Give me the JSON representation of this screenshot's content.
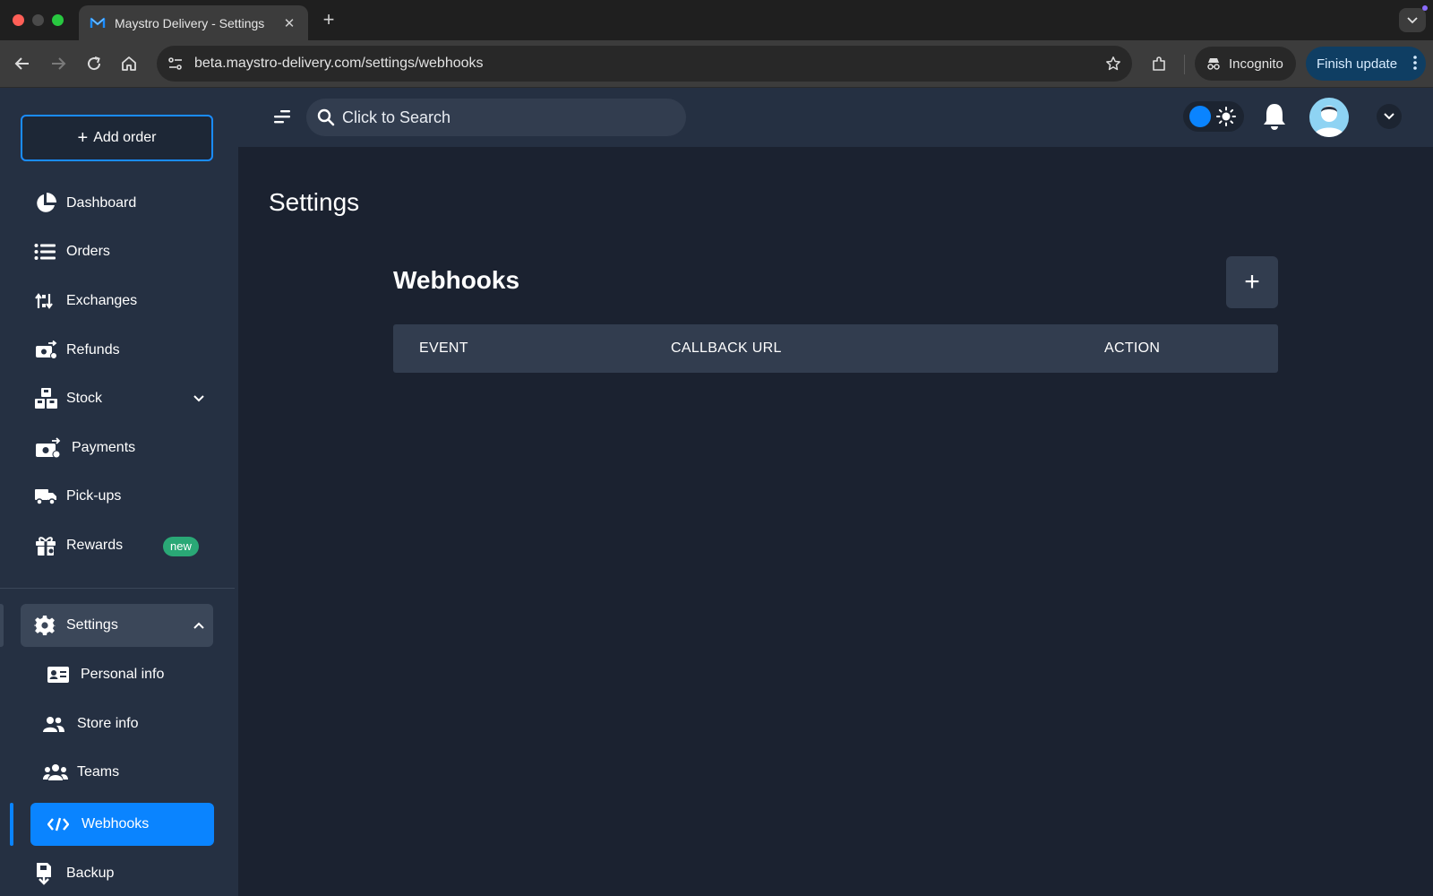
{
  "browser": {
    "tab_title": "Maystro Delivery - Settings",
    "url": "beta.maystro-delivery.com/settings/webhooks",
    "incognito_label": "Incognito",
    "finish_update_label": "Finish update"
  },
  "sidebar": {
    "add_order_label": "Add order",
    "items": [
      {
        "label": "Dashboard"
      },
      {
        "label": "Orders"
      },
      {
        "label": "Exchanges"
      },
      {
        "label": "Refunds"
      },
      {
        "label": "Stock"
      },
      {
        "label": "Payments"
      },
      {
        "label": "Pick-ups"
      },
      {
        "label": "Rewards",
        "badge": "new"
      }
    ],
    "settings": {
      "label": "Settings",
      "children": [
        {
          "label": "Personal info"
        },
        {
          "label": "Store info"
        },
        {
          "label": "Teams"
        },
        {
          "label": "Webhooks",
          "active": true
        }
      ]
    },
    "backup_label": "Backup"
  },
  "appbar": {
    "search_placeholder": "Click to Search"
  },
  "main": {
    "page_title": "Settings",
    "section_title": "Webhooks",
    "add_button_label": "+",
    "table": {
      "columns": [
        "EVENT",
        "CALLBACK URL",
        "ACTION"
      ],
      "rows": []
    }
  },
  "colors": {
    "accent": "#0a84ff",
    "background": "#1b2230",
    "sidebar": "#253042",
    "badge_new": "#2aa876"
  }
}
